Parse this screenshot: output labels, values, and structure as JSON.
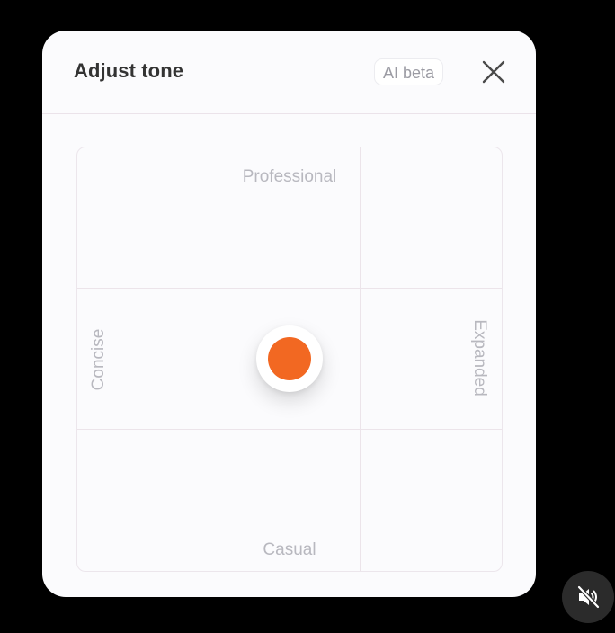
{
  "dialog": {
    "title": "Adjust tone",
    "badge": "AI beta",
    "close_icon": "close-icon"
  },
  "tone_grid": {
    "top_label": "Professional",
    "bottom_label": "Casual",
    "left_label": "Concise",
    "right_label": "Expanded",
    "rows": 3,
    "columns": 3,
    "selected_cell": {
      "row": 2,
      "column": 2
    },
    "knob_color": "#f26822"
  },
  "video_controls": {
    "mute_icon": "speaker-muted-icon"
  },
  "colors": {
    "background": "#000000",
    "panel": "#fbfbfd",
    "accent": "#f26822",
    "label_text": "#b8b8bf",
    "title_text": "#333333"
  }
}
